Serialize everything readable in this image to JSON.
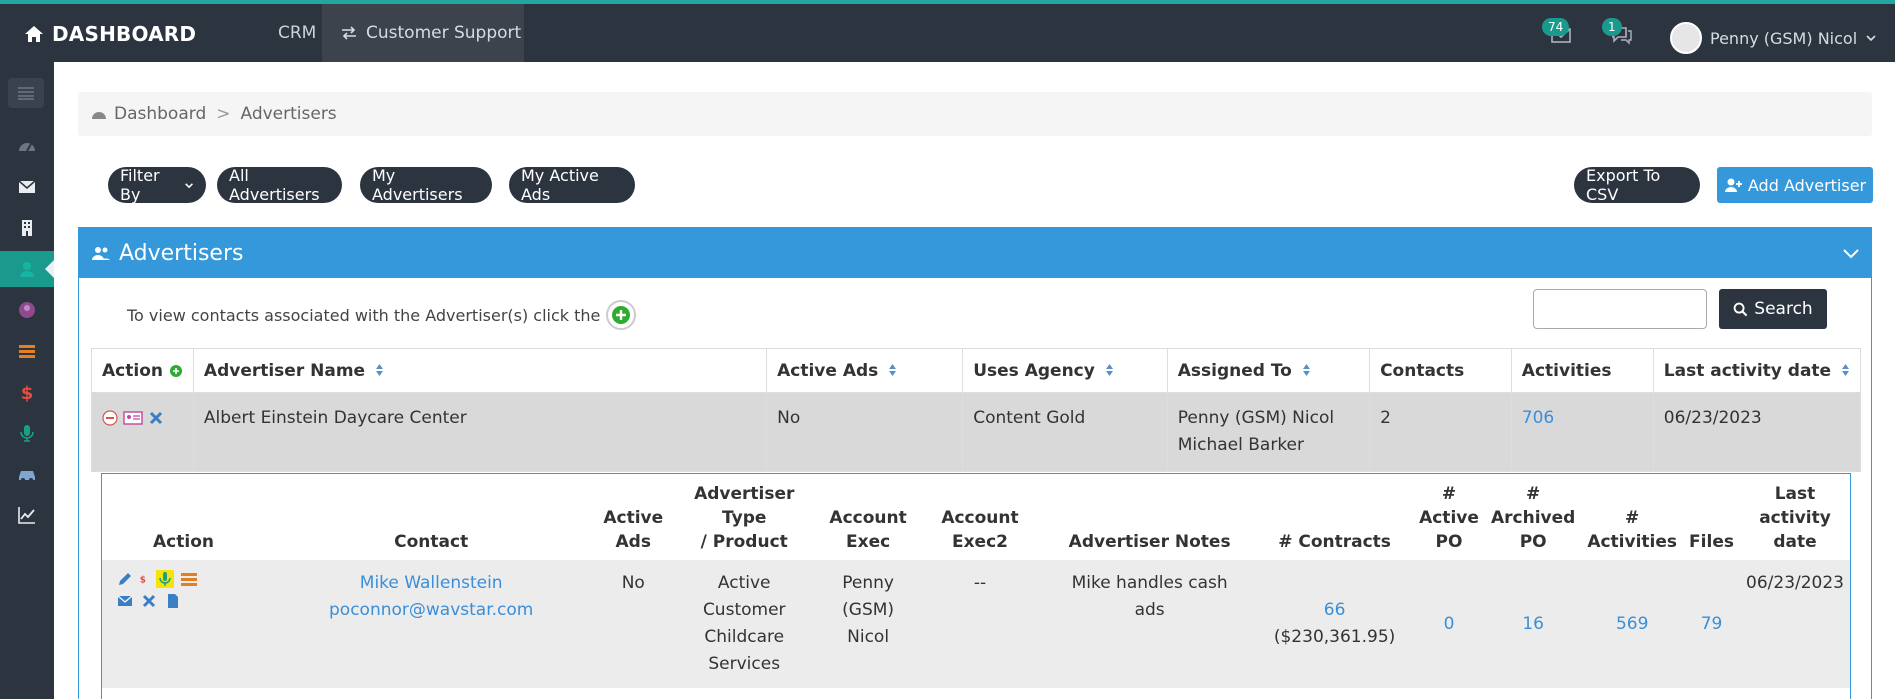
{
  "topbar": {
    "brand": "DASHBOARD",
    "nav_crm": "CRM",
    "nav_customer_support": "Customer Support",
    "mail_badge": "74",
    "chat_badge": "1",
    "user_name": "Penny (GSM) Nicol"
  },
  "breadcrumb": {
    "home": "Dashboard",
    "separator": ">",
    "current": "Advertisers"
  },
  "toolbar": {
    "filter_by": "Filter By",
    "all_advertisers": "All Advertisers",
    "my_advertisers": "My Advertisers",
    "my_active_ads": "My Active Ads",
    "export_csv": "Export To CSV",
    "add_advertiser": "Add Advertiser"
  },
  "panel": {
    "title": "Advertisers",
    "hint": "To view contacts associated with the Advertiser(s) click the",
    "search_placeholder": "",
    "search_label": "Search"
  },
  "table": {
    "headers": [
      "Action",
      "Advertiser Name",
      "Active Ads",
      "Uses Agency",
      "Assigned To",
      "Contacts",
      "Activities",
      "Last activity date"
    ],
    "row": {
      "name": "Albert Einstein Daycare Center",
      "active_ads": "No",
      "uses_agency": "Content Gold",
      "assigned_1": "Penny (GSM) Nicol",
      "assigned_2": "Michael Barker",
      "contacts": "2",
      "activities": "706",
      "last_activity": "06/23/2023"
    }
  },
  "subtable": {
    "headers": {
      "action": "Action",
      "contact": "Contact",
      "active_ads_1": "Active",
      "active_ads_2": "Ads",
      "type_1": "Advertiser Type",
      "type_2": "/ Product",
      "exec_1": "Account",
      "exec_2": "Exec",
      "exec2_1": "Account",
      "exec2_2": "Exec2",
      "notes": "Advertiser Notes",
      "contracts": "# Contracts",
      "active_po_1": "#",
      "active_po_2": "Active",
      "active_po_3": "PO",
      "archived_po_1": "#",
      "archived_po_2": "Archived",
      "archived_po_3": "PO",
      "activities_1": "#",
      "activities_2": "Activities",
      "files": "Files",
      "last_1": "Last activity",
      "last_2": "date"
    },
    "row": {
      "contact_name": "Mike Wallenstein",
      "contact_email": "poconnor@wavstar.com",
      "active_ads": "No",
      "type_1": "Active",
      "type_2": "Customer",
      "type_3": "Childcare",
      "type_4": "Services",
      "exec_1": "Penny",
      "exec_2": "(GSM)",
      "exec_3": "Nicol",
      "exec2": "--",
      "notes_1": "Mike handles cash",
      "notes_2": "ads",
      "contracts": "66",
      "contracts_amount": "($230,361.95)",
      "active_po": "0",
      "archived_po": "16",
      "activities": "569",
      "files": "79",
      "last_activity": "06/23/2023"
    }
  },
  "colors": {
    "navbar": "#2c3440",
    "accent": "#1a9a8c",
    "primary": "#3498db",
    "link": "#3a8fd8"
  }
}
